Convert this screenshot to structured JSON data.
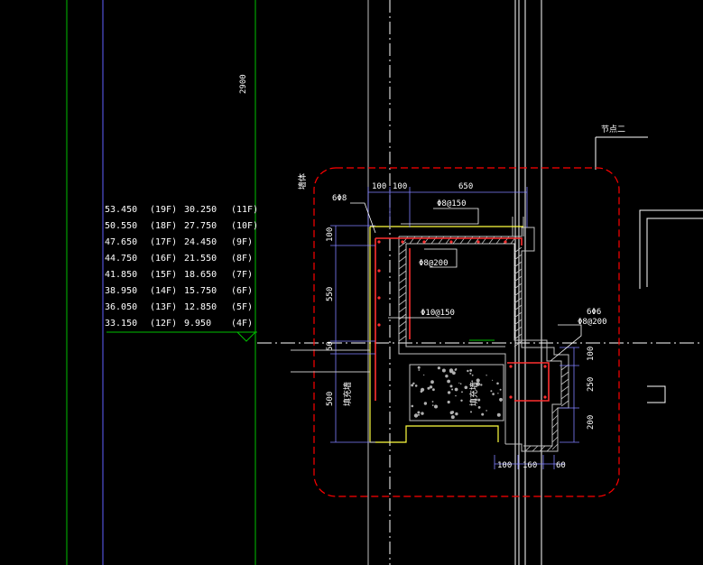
{
  "drawing": {
    "node_title": "节点二",
    "top_dimension": "2900",
    "vertical_tag": "墙体",
    "elevation_table": [
      [
        "53.450",
        "(19F)",
        "30.250",
        "(11F)"
      ],
      [
        "50.550",
        "(18F)",
        "27.750",
        "(10F)"
      ],
      [
        "47.650",
        "(17F)",
        "24.450",
        "(9F)"
      ],
      [
        "44.750",
        "(16F)",
        "21.550",
        "(8F)"
      ],
      [
        "41.850",
        "(15F)",
        "18.650",
        "(7F)"
      ],
      [
        "38.950",
        "(14F)",
        "15.750",
        "(6F)"
      ],
      [
        "36.050",
        "(13F)",
        "12.850",
        "(5F)"
      ],
      [
        "33.150",
        "(12F)",
        "9.950",
        "(4F)"
      ]
    ],
    "dims": {
      "top": [
        "100",
        "100",
        "650"
      ],
      "left": [
        "100",
        "550",
        "50",
        "500"
      ],
      "right": [
        "100",
        "250",
        "200"
      ],
      "bottom": [
        "100",
        "160",
        "60"
      ]
    },
    "rebar_labels": {
      "top_bars": "6Φ8",
      "top_stirrup": "Φ8@150",
      "mid_stirrup": "Φ8@200",
      "wall_bars": "Φ10@150",
      "corner_bars": "6Φ6",
      "corner_stirrup": "Φ8@200"
    },
    "fill_labels": {
      "left": "填充墙",
      "center": "填充墙"
    },
    "colors": {
      "background": "#000000",
      "detail_boundary": "#ff0000",
      "rebar": "#ff3030",
      "grid_green": "#00c000",
      "grid_blue": "#6060ff",
      "outline_yellow": "#ffff40",
      "dimension_white": "#ffffff",
      "wall_hatch": "#c0c0c0"
    }
  }
}
